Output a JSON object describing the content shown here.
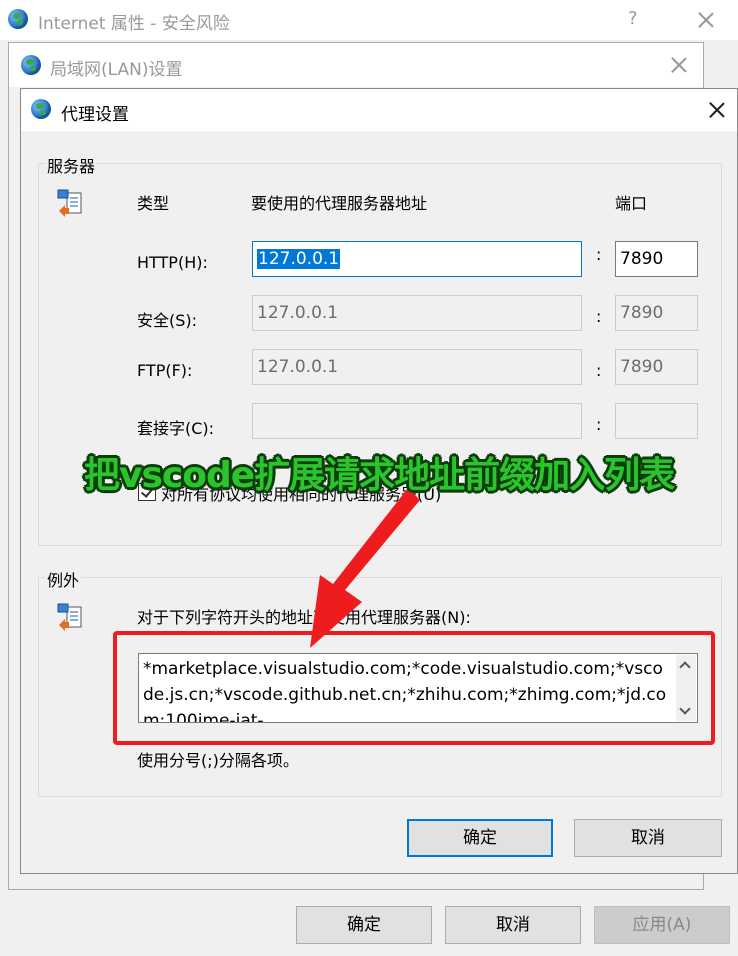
{
  "main_window": {
    "title": "Internet 属性 - 安全风险",
    "help": "?",
    "buttons": {
      "ok": "确定",
      "cancel": "取消",
      "apply": "应用(A)"
    }
  },
  "lan_window": {
    "title": "局域网(LAN)设置"
  },
  "proxy_dialog": {
    "title": "代理设置",
    "servers": {
      "group_label": "服务器",
      "col_type": "类型",
      "col_address": "要使用的代理服务器地址",
      "col_port": "端口",
      "rows": [
        {
          "label": "HTTP(H):",
          "address": "127.0.0.1",
          "port": "7890",
          "enabled": true
        },
        {
          "label": "安全(S):",
          "address": "127.0.0.1",
          "port": "7890",
          "enabled": false
        },
        {
          "label": "FTP(F):",
          "address": "127.0.0.1",
          "port": "7890",
          "enabled": false
        },
        {
          "label": "套接字(C):",
          "address": "",
          "port": "",
          "enabled": false
        }
      ],
      "colon": ":",
      "same_proxy_label": "对所有协议均使用相同的代理服务器(U)",
      "same_proxy_checked": true
    },
    "exceptions": {
      "group_label": "例外",
      "description": "对于下列字符开头的地址不使用代理服务器(N):",
      "value": "*marketplace.visualstudio.com;*code.visualstudio.com;*vscode.js.cn;*vscode.github.net.cn;*zhihu.com;*zhimg.com;*jd.com:100ime-jat-",
      "hint": "使用分号(;)分隔各项。"
    },
    "buttons": {
      "ok": "确定",
      "cancel": "取消"
    }
  },
  "annotation": {
    "text": "把vscode扩展请求地址前缀加入列表",
    "color": "#2cc42c",
    "arrow_color": "#ee1c1c",
    "box_color": "#ee1c1c"
  }
}
